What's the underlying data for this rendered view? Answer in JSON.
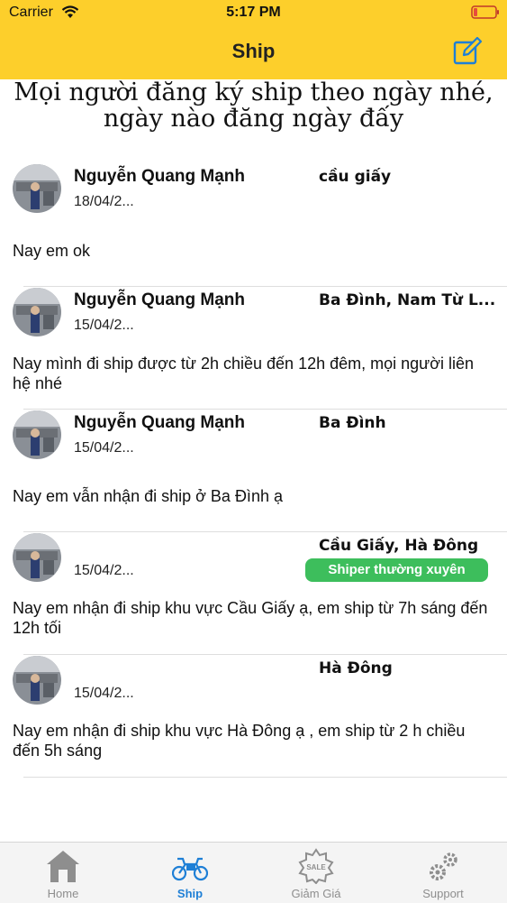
{
  "status": {
    "carrier": "Carrier",
    "time": "5:17 PM"
  },
  "nav": {
    "title": "Ship",
    "compose_icon": "compose-icon"
  },
  "notice": "Mọi người đăng ký ship theo ngày nhé, ngày nào đăng ngày đấy",
  "posts": [
    {
      "name": "Nguyễn Quang Mạnh",
      "date": "18/04/2...",
      "area": "cầu giấy",
      "badge": "",
      "content": "Nay em ok"
    },
    {
      "name": "Nguyễn Quang Mạnh",
      "date": "15/04/2...",
      "area": "Ba Đình, Nam Từ L...",
      "badge": "",
      "content": "Nay mình đi ship được từ 2h chiều đến 12h đêm, mọi người liên hệ nhé"
    },
    {
      "name": "Nguyễn Quang Mạnh",
      "date": "15/04/2...",
      "area": "Ba Đình",
      "badge": "",
      "content": "Nay em vẫn nhận đi ship ở Ba Đình ạ"
    },
    {
      "name": "",
      "date": "15/04/2...",
      "area": "Cầu Giấy, Hà Đông",
      "badge": "Shiper thường xuyên",
      "content": "Nay em nhận đi ship khu vực Cầu Giấy ạ, em ship từ 7h sáng đến 12h tối"
    },
    {
      "name": "",
      "date": "15/04/2...",
      "area": "Hà Đông",
      "badge": "",
      "content": "Nay em nhận đi ship khu vực Hà Đông ạ , em ship từ 2 h chiều đến 5h sáng"
    }
  ],
  "tabs": [
    {
      "label": "Home",
      "icon": "home-icon",
      "active": false
    },
    {
      "label": "Ship",
      "icon": "motorbike-icon",
      "active": true
    },
    {
      "label": "Giảm Giá",
      "icon": "sale-badge-icon",
      "active": false
    },
    {
      "label": "Support",
      "icon": "gears-icon",
      "active": false
    }
  ],
  "colors": {
    "header": "#FDCF2B",
    "accent": "#1E7FD6",
    "badge": "#3DBE5C"
  }
}
